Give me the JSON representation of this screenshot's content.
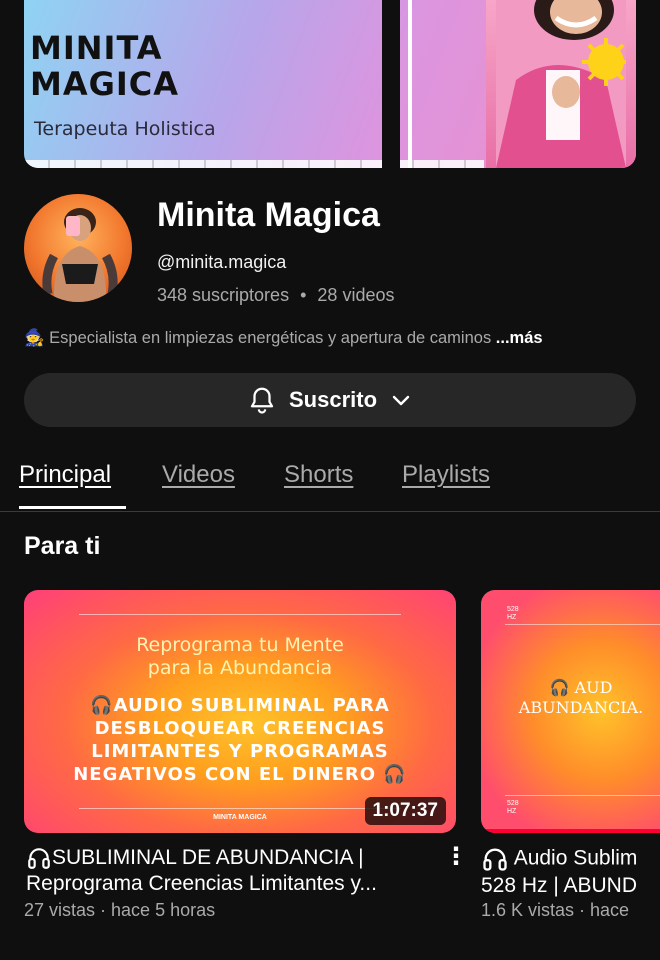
{
  "banner": {
    "title": "MINITA\nMAGICA",
    "subtitle": "Terapeuta Holistica"
  },
  "channel": {
    "name": "Minita Magica",
    "handle": "@minita.magica",
    "subscribers": "348 suscriptores",
    "separator": "•",
    "videos": "28 videos",
    "description": "Especialista en limpiezas energéticas y apertura de caminos",
    "more": "...más",
    "description_emoji": "🧙"
  },
  "subscribe": {
    "label": "Suscrito"
  },
  "tabs": [
    {
      "label": "Principal",
      "active": true
    },
    {
      "label": "Videos",
      "active": false
    },
    {
      "label": "Shorts",
      "active": false
    },
    {
      "label": "Playlists",
      "active": false
    }
  ],
  "section_title": "Para ti",
  "videos": [
    {
      "thumb_top": "Reprograma tu Mente\npara la Abundancia",
      "thumb_main": "🎧AUDIO SUBLIMINAL PARA\nDESBLOQUEAR CREENCIAS\nLIMITANTES Y PROGRAMAS\nNEGATIVOS CON EL DINERO 🎧",
      "thumb_foot": "MINITA MAGICA",
      "duration": "1:07:37",
      "title_line1": "SUBLIMINAL DE ABUNDANCIA |",
      "title_line2": "Reprograma Creencias Limitantes y...",
      "meta": "27 vistas · hace 5 horas"
    },
    {
      "thumb_hz": "528\nHZ",
      "thumb_line1": "🎧 AUD",
      "thumb_line2": "ABUNDANCIA.",
      "title_line1": "Audio Sublim",
      "title_line2": "528 Hz | ABUND",
      "meta": "1.6 K vistas · hace"
    }
  ],
  "colors": {
    "background": "#0f0f0f",
    "button_bg": "#272727",
    "muted_text": "#aaaaaa",
    "progress_red": "#ff0033"
  }
}
